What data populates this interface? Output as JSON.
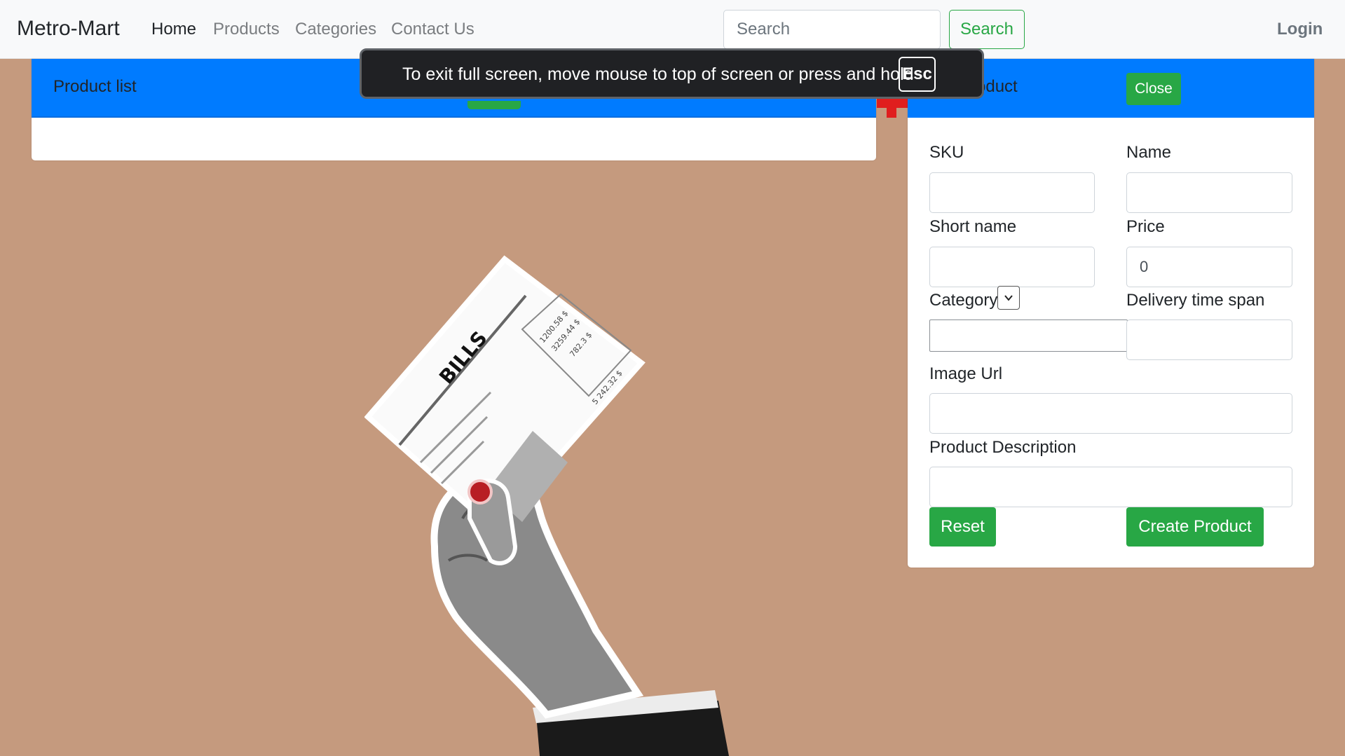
{
  "navbar": {
    "brand": "Metro-Mart",
    "links": [
      "Home",
      "Products",
      "Categories",
      "Contact Us"
    ],
    "search_placeholder": "Search",
    "search_button": "Search",
    "login": "Login"
  },
  "product_list": {
    "title": "Product list"
  },
  "create_product": {
    "title_visible": "oduct",
    "close_button": "Close",
    "fields": {
      "sku_label": "SKU",
      "name_label": "Name",
      "short_name_label": "Short name",
      "price_label": "Price",
      "price_value": "0",
      "category_label": "Category",
      "delivery_label": "Delivery time span",
      "image_url_label": "Image Url",
      "description_label": "Product Description"
    },
    "reset_button": "Reset",
    "create_button": "Create Product"
  },
  "fullscreen_toast": {
    "message": "To exit full screen, move mouse to top of screen or press and hold",
    "key": "Esc"
  },
  "illustration": {
    "bill_title": "BILLS",
    "amounts": [
      "1200.58 $",
      "3259.44 $",
      "782.3 $",
      "5 242.32 $"
    ]
  },
  "colors": {
    "primary": "#007bff",
    "success": "#28a745",
    "background": "#c59a7e"
  }
}
